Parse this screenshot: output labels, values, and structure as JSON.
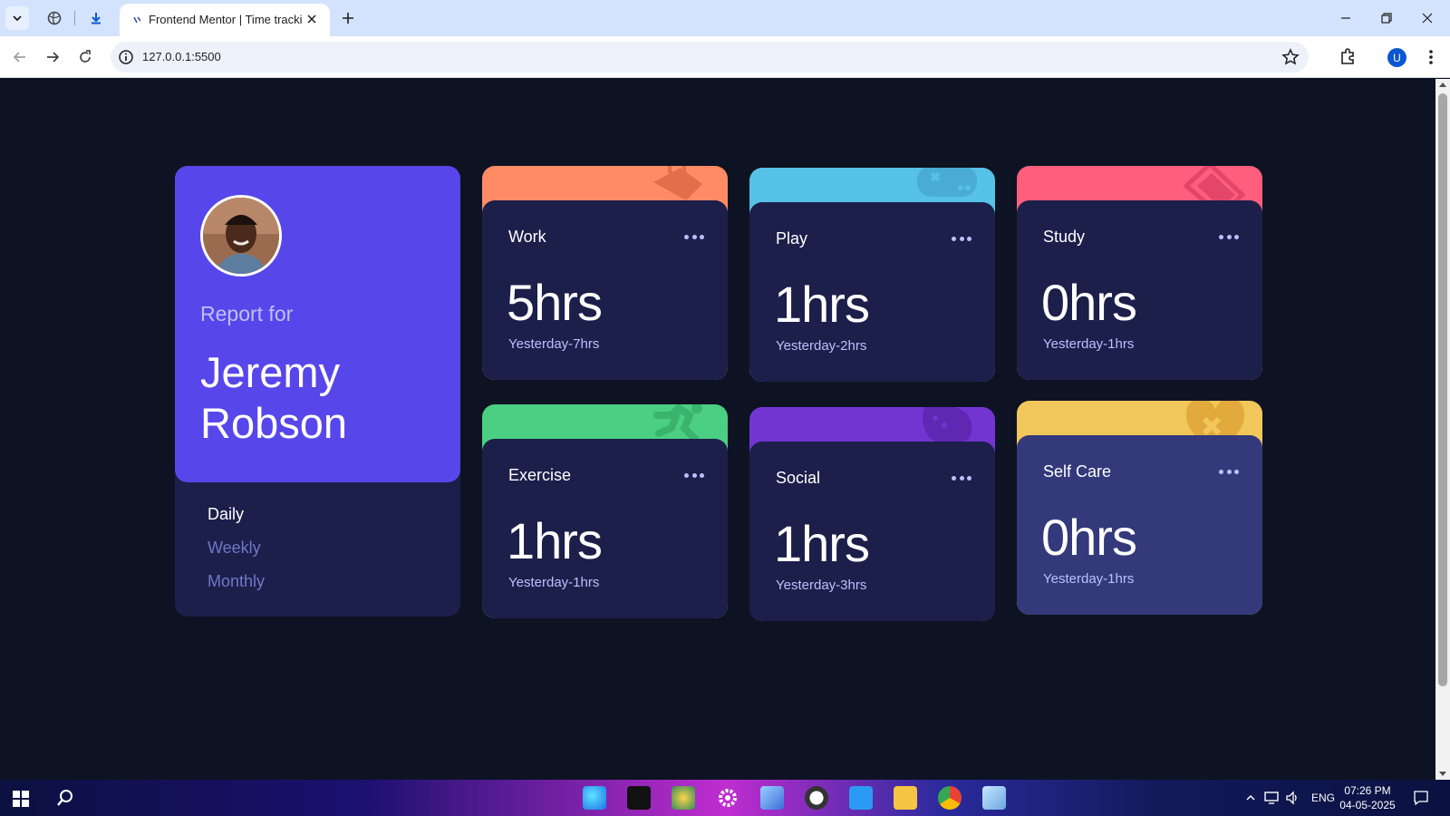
{
  "browser": {
    "tab_title": "Frontend Mentor | Time tracking",
    "url": "127.0.0.1:5500"
  },
  "profile": {
    "report_for": "Report for",
    "name": "Jeremy Robson",
    "periods": [
      "Daily",
      "Weekly",
      "Monthly"
    ],
    "active_period": "Daily"
  },
  "activities": [
    {
      "label": "Work",
      "hours": "5hrs",
      "previous": "Yesterday-7hrs",
      "color": "#ff8b64",
      "icon": "briefcase-icon"
    },
    {
      "label": "Play",
      "hours": "1hrs",
      "previous": "Yesterday-2hrs",
      "color": "#55c2e6",
      "icon": "gamepad-icon"
    },
    {
      "label": "Study",
      "hours": "0hrs",
      "previous": "Yesterday-1hrs",
      "color": "#ff5e7d",
      "icon": "book-icon"
    },
    {
      "label": "Exercise",
      "hours": "1hrs",
      "previous": "Yesterday-1hrs",
      "color": "#4bcf82",
      "icon": "running-icon"
    },
    {
      "label": "Social",
      "hours": "1hrs",
      "previous": "Yesterday-3hrs",
      "color": "#7335d2",
      "icon": "social-icon"
    },
    {
      "label": "Self Care",
      "hours": "0hrs",
      "previous": "Yesterday-1hrs",
      "color": "#f1c75b",
      "icon": "heart-icon"
    }
  ],
  "taskbar": {
    "language": "ENG",
    "time": "07:26 PM",
    "date": "04-05-2025"
  },
  "colors": {
    "page_bg": "#0e1323",
    "card_bg": "#1c1f4a",
    "card_hover_bg": "#33397a",
    "profile_bg": "#5747ea",
    "muted_text": "#bbc0ff"
  }
}
